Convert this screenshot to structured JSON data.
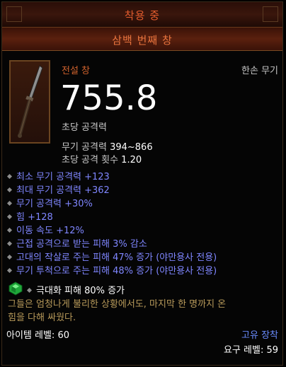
{
  "header": {
    "equipped": "착용 중",
    "item_name": "삼백 번째 창"
  },
  "item": {
    "rarity_type": "전설 창",
    "slot": "한손 무기",
    "dps": "755.8",
    "dps_label": "초당 공격력",
    "damage_label": "무기 공격력",
    "damage_value": "394~866",
    "speed_label": "초당 공격 횟수",
    "speed_value": "1.20"
  },
  "affixes": [
    "최소 무기 공격력 +123",
    "최대 무기 공격력 +362",
    "무기 공격력 +30%",
    "힘 +128",
    "이동 속도 +12%",
    "근접 공격으로 받는 피해 3% 감소",
    "고대의 작살로 주는 피해 47% 증가 (야만용사 전용)",
    "무기 투척으로 주는 피해 48% 증가 (야만용사 전용)"
  ],
  "socket": {
    "icon": "emerald-gem-icon",
    "text": "극대화 피해 80% 증가"
  },
  "flavor_lines": [
    "그들은 엄청나게 불리한 상황에서도, 마지막 한 명까지 온",
    "힘을 다해 싸웠다."
  ],
  "footer": {
    "item_level": "아이템 레벨: 60",
    "account_bound": "고유 장착",
    "required_level": "요구 레벨: 59"
  },
  "colors": {
    "legendary": "#d2632d",
    "affix": "#7f86ff",
    "flavor": "#b89a5a",
    "bound": "#6a8cff"
  }
}
